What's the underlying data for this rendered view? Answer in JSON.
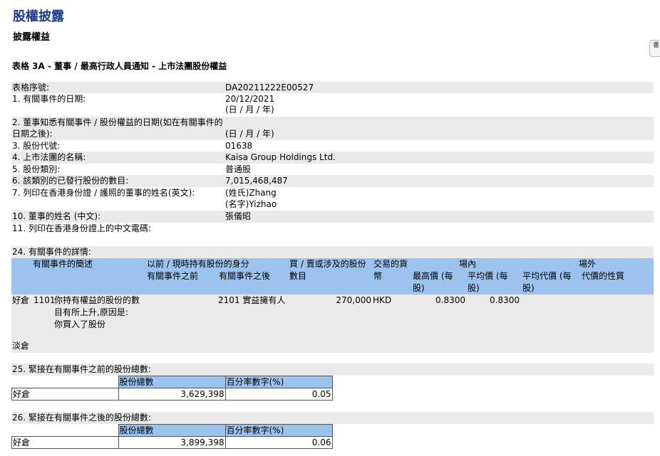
{
  "header": {
    "title": "股權披露",
    "subtitle": "披露權益",
    "side_tab": "書"
  },
  "form_title": "表格 3A - 董事 / 最高行政人員通知 - 上市法團股份權益",
  "fields": {
    "serial_label": "表格序號:",
    "serial_value": "DA20211222E00527",
    "event_date_label": "1. 有關事件的日期:",
    "event_date_value": "20/12/2021",
    "event_date_fmt": "(日 / 月 / 年)",
    "aware_date_label_1": "2. 董事知悉有關事件 / 股份權益的日期(如在有關事件的",
    "aware_date_label_2": "日期之後):",
    "aware_date_fmt": "(日 / 月 / 年)",
    "stock_code_label": "3. 股份代號:",
    "stock_code_value": "01638",
    "corp_name_label": "4. 上市法團的名稱:",
    "corp_name_value": "Kaisa Group Holdings Ltd.",
    "share_class_label": "5. 股份類別:",
    "share_class_value": "普通股",
    "issued_label": "6. 該類別的已發行股份的數目:",
    "issued_value": "7,015,468,487",
    "name_en_label": "7. 列印在香港身份證 / 護照的董事的姓名(英文):",
    "surname_value": "(姓氏)Zhang",
    "given_value": "(名字)Yizhao",
    "name_cn_label": "10. 董事的姓名 (中文):",
    "name_cn_value": "張儀昭",
    "code_label": "11. 列印在香港身份證上的中文電碼:"
  },
  "section24": {
    "caption": "24. 有關事件的詳情:",
    "headers": {
      "desc": "有關事件的簡述",
      "capacity": "以前 / 現時持有股份的身分",
      "before": "有關事件之前",
      "after": "有關事件之後",
      "qty_1": "買 / 賣或涉及的股份",
      "qty_2": "數目",
      "currency_1": "交易的貨",
      "currency_2": "幣",
      "on_exchange": "場內",
      "high_1": "最高價 (每",
      "high_2": "股)",
      "avg_1": "平均價 (每",
      "avg_2": "股)",
      "off_exchange": "場外",
      "off_avg_1": "平均代價 (每",
      "off_avg_2": "股)",
      "nature": "代價的性質"
    },
    "row": {
      "position": "好倉",
      "code": "1101",
      "desc_1": "你持有權益的股份的數",
      "desc_2": "目有所上升,原因是:",
      "desc_3": "你買入了股份",
      "capacity_after": "2101 實益擁有人",
      "qty": "270,000",
      "currency": "HKD",
      "high": "0.8300",
      "avg": "0.8300"
    },
    "short_label": "淡倉"
  },
  "section25": {
    "caption": "25. 緊接在有關事件之前的股份總數:",
    "col_shares": "股份總數",
    "col_pct": "百分率數字(%)",
    "row_label": "好倉",
    "shares": "3,629,398",
    "pct": "0.05"
  },
  "section26": {
    "caption": "26. 緊接在有關事件之後的股份總數:",
    "col_shares": "股份總數",
    "col_pct": "百分率數字(%)",
    "row_label": "好倉",
    "shares": "3,899,398",
    "pct": "0.06"
  }
}
